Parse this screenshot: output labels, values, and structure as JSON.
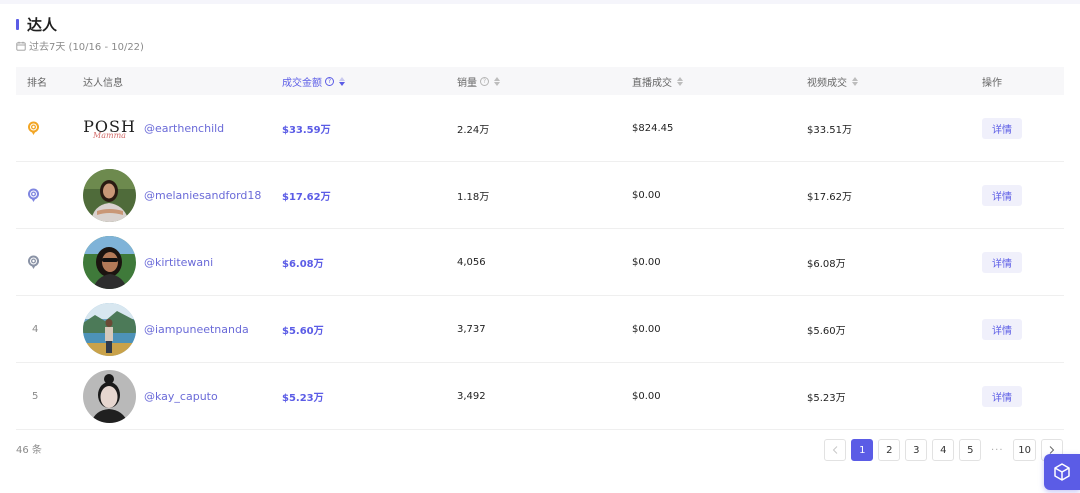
{
  "section": {
    "title": "达人",
    "date_range": "过去7天 (10/16 - 10/22)"
  },
  "columns": {
    "rank": "排名",
    "creator": "达人信息",
    "gmv": "成交金额",
    "sales": "销量",
    "live_gmv": "直播成交",
    "video_gmv": "视频成交",
    "action": "操作"
  },
  "rows": [
    {
      "rank": "1",
      "rank_medal": "gold",
      "handle": "@earthenchild",
      "avatar": "posh-logo",
      "gmv": "$33.59万",
      "sales": "2.24万",
      "live_gmv": "$824.45",
      "video_gmv": "$33.51万",
      "action": "详情",
      "logo_text": "POSH",
      "logo_sub": "Mamma"
    },
    {
      "rank": "2",
      "rank_medal": "silver",
      "handle": "@melaniesandford18",
      "avatar": "photo-woman-arms-crossed",
      "gmv": "$17.62万",
      "sales": "1.18万",
      "live_gmv": "$0.00",
      "video_gmv": "$17.62万",
      "action": "详情"
    },
    {
      "rank": "3",
      "rank_medal": "bronze",
      "handle": "@kirtitewani",
      "avatar": "photo-woman-sunglasses",
      "gmv": "$6.08万",
      "sales": "4,056",
      "live_gmv": "$0.00",
      "video_gmv": "$6.08万",
      "action": "详情"
    },
    {
      "rank": "4",
      "rank_medal": "",
      "handle": "@iampuneetnanda",
      "avatar": "photo-man-lake",
      "gmv": "$5.60万",
      "sales": "3,737",
      "live_gmv": "$0.00",
      "video_gmv": "$5.60万",
      "action": "详情"
    },
    {
      "rank": "5",
      "rank_medal": "",
      "handle": "@kay_caputo",
      "avatar": "photo-woman-bun",
      "gmv": "$5.23万",
      "sales": "3,492",
      "live_gmv": "$0.00",
      "video_gmv": "$5.23万",
      "action": "详情"
    }
  ],
  "footer": {
    "total": "46 条",
    "pages": [
      "1",
      "2",
      "3",
      "4",
      "5"
    ],
    "last_page": "10",
    "current_page": "1",
    "ellipsis": "···"
  },
  "colors": {
    "accent": "#5b5ce6",
    "gold": "#f2a626",
    "silver": "#7f86e0",
    "bronze": "#8a93a6"
  },
  "icons": {
    "calendar": "calendar-icon",
    "prev": "chevron-left-icon",
    "next": "chevron-right-icon",
    "float": "cube-icon"
  }
}
